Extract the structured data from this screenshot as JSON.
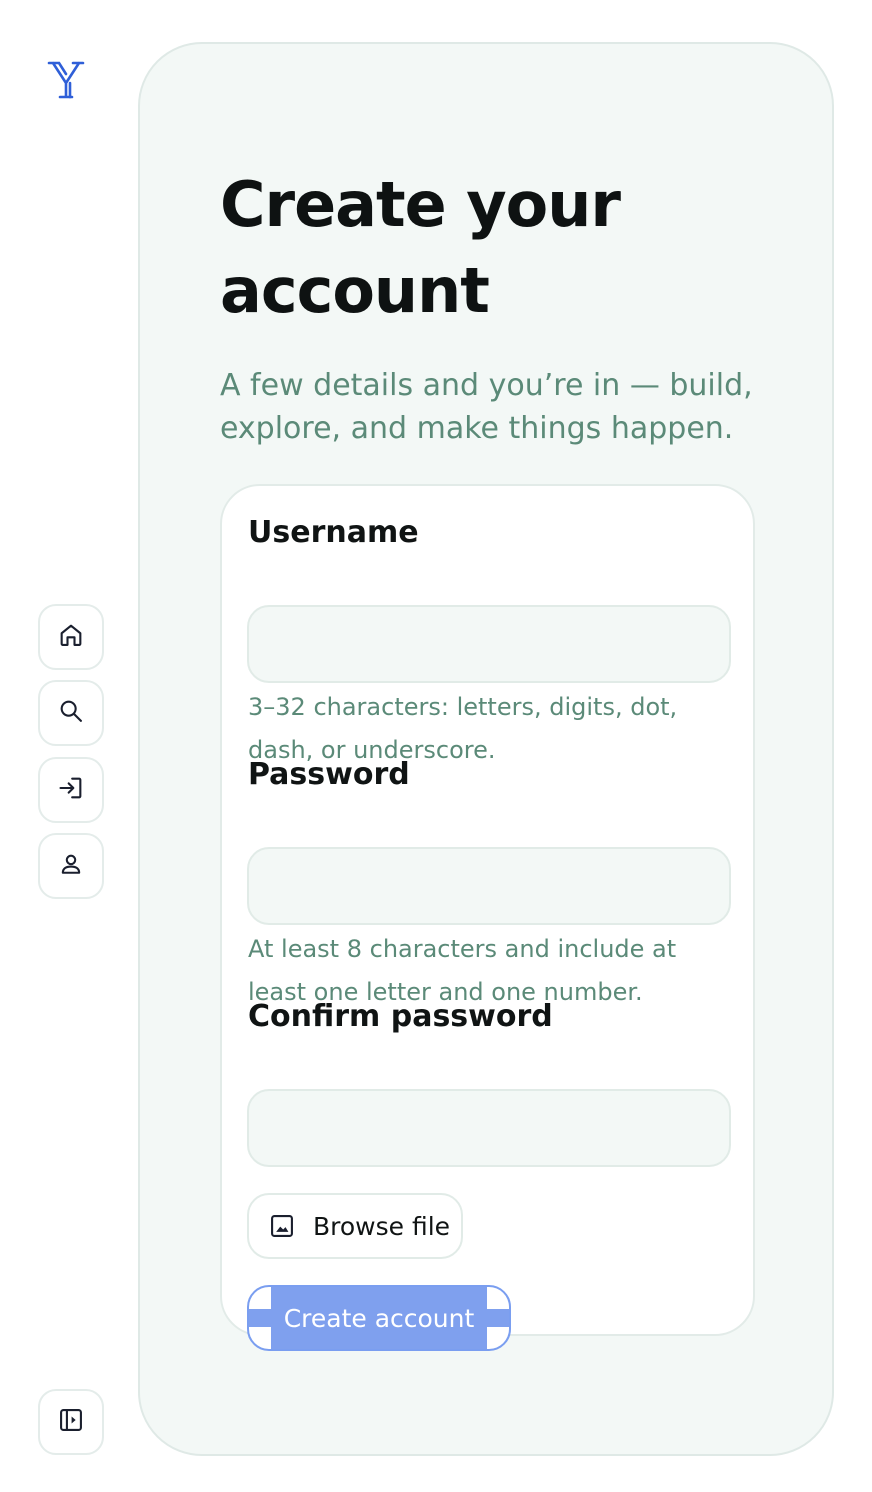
{
  "sidebar": {
    "logo_icon": "y-logo-icon",
    "nav": [
      {
        "name": "home",
        "icon": "home-icon"
      },
      {
        "name": "search",
        "icon": "search-icon"
      },
      {
        "name": "sign-in",
        "icon": "sign-in-icon"
      },
      {
        "name": "profile",
        "icon": "user-icon"
      }
    ],
    "toggle_icon": "sidebar-toggle-icon"
  },
  "main": {
    "title": "Create your account",
    "subtitle": "A few details and you’re in — build, explore, and make things happen."
  },
  "form": {
    "username": {
      "label": "Username",
      "value": "",
      "placeholder": "",
      "hint": "3–32 characters: letters, digits, dot, dash, or underscore."
    },
    "password": {
      "label": "Password",
      "value": "",
      "placeholder": "",
      "hint": "At least 8 characters and include at least one letter and one number."
    },
    "confirm_password": {
      "label": "Confirm password",
      "value": "",
      "placeholder": ""
    },
    "browse_label": "Browse file",
    "browse_icon": "image-icon",
    "submit_label": "Create account"
  },
  "colors": {
    "accent": "#7fa0ee",
    "logo": "#2f5fd8",
    "hint_text": "#5b8a78",
    "panel_bg": "#f3f8f6"
  }
}
